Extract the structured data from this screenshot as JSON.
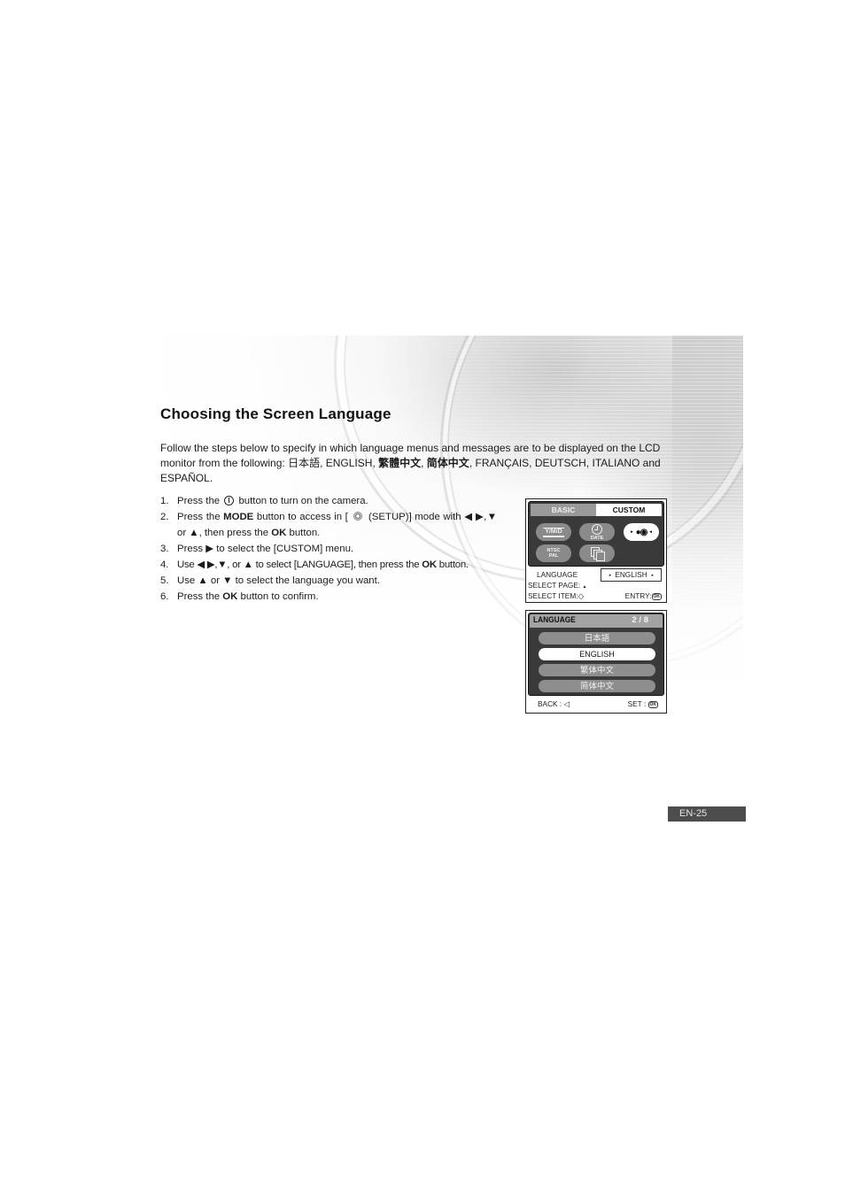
{
  "page": {
    "title": "Choosing the Screen Language",
    "intro": {
      "text_before": "Follow the steps below to specify in which language menus and messages are to be displayed on the LCD monitor from the following: ",
      "languages": [
        "日本語",
        "ENGLISH",
        "繁體中文",
        "简体中文",
        "FRANÇAIS",
        "DEUTSCH",
        "ITALIANO",
        "ESPAÑOL"
      ],
      "sep": ", ",
      "and": " and "
    },
    "steps": [
      {
        "num": "1.",
        "parts": [
          {
            "t": "Press the "
          },
          {
            "icon": "power-icon"
          },
          {
            "t": " button to turn on the camera."
          }
        ]
      },
      {
        "num": "2.",
        "parts": [
          {
            "t": "Press the "
          },
          {
            "b": "MODE"
          },
          {
            "t": " button to access in [ "
          },
          {
            "icon": "setup-icon"
          },
          {
            "t": " (SETUP)] mode with ◀ ▶,▼ or ▲, then press the "
          },
          {
            "b": "OK"
          },
          {
            "t": " button."
          }
        ]
      },
      {
        "num": "3.",
        "parts": [
          {
            "t": "Press ▶ to select the [CUSTOM] menu."
          }
        ]
      },
      {
        "num": "4.",
        "parts": [
          {
            "t": "Use ◀ ▶,▼, or ▲ to select [LANGUAGE], then press the "
          },
          {
            "b": "OK"
          },
          {
            "t": " button."
          }
        ]
      },
      {
        "num": "5.",
        "parts": [
          {
            "t": "Use ▲ or ▼ to select the language you want."
          }
        ]
      },
      {
        "num": "6.",
        "parts": [
          {
            "t": "Press the "
          },
          {
            "b": "OK"
          },
          {
            "t": " button to confirm."
          }
        ]
      }
    ],
    "page_number": "EN-25"
  },
  "lcd_custom_menu": {
    "tabs": {
      "basic": "BASIC",
      "custom": "CUSTOM"
    },
    "active_tab": "CUSTOM",
    "icons": [
      {
        "name": "date-format-icon",
        "label": "Y/M/D"
      },
      {
        "name": "date-icon",
        "label": "DATE"
      },
      {
        "name": "language-icon",
        "label": "",
        "selected": true
      },
      {
        "name": "video-output-icon",
        "label_top": "NTSC",
        "label_bottom": "PAL"
      },
      {
        "name": "repeat-frames-icon",
        "label": ""
      }
    ],
    "setting_label": "LANGUAGE",
    "setting_value": "ENGLISH",
    "select_page": "SELECT PAGE:",
    "select_item": "SELECT ITEM:",
    "entry": "ENTRY:",
    "ok_glyph": "OK",
    "up_glyph": "▲",
    "dpad_glyph": "◇",
    "arrow_left": "◂",
    "arrow_right": "▸"
  },
  "lcd_language_menu": {
    "title": "LANGUAGE",
    "page": "2 / 8",
    "options": [
      "日本語",
      "ENGLISH",
      "繁体中文",
      "简体中文"
    ],
    "selected": "ENGLISH",
    "back": "BACK :",
    "back_glyph": "◁",
    "set": "SET :",
    "ok_glyph": "OK"
  }
}
